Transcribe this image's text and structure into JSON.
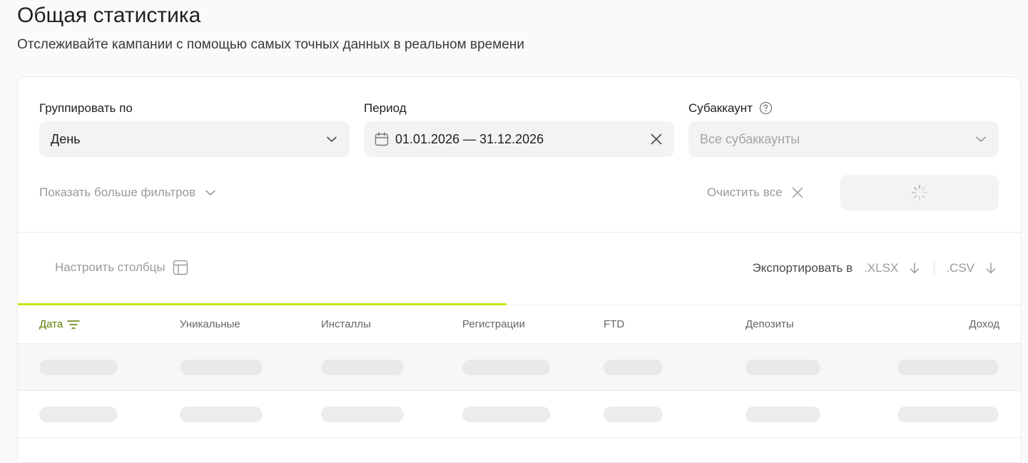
{
  "header": {
    "title": "Общая статистика",
    "subtitle": "Отслеживайте кампании с помощью самых точных данных в реальном времени"
  },
  "filters": {
    "group_by": {
      "label": "Группировать по",
      "value": "День",
      "icon": "chevron-down-icon"
    },
    "period": {
      "label": "Период",
      "value": "01.01.2026 — 31.12.2026",
      "icon": "calendar-icon",
      "clear_icon": "close-icon"
    },
    "subaccount": {
      "label": "Субаккаунт",
      "placeholder": "Все субаккаунты",
      "help_icon": "question-circle-icon",
      "icon": "chevron-down-icon"
    },
    "more_filters_label": "Показать больше фильтров",
    "clear_all_label": "Очистить все",
    "apply_state": "loading"
  },
  "toolbar": {
    "configure_columns_label": "Настроить столбцы",
    "export_label": "Экспортировать в",
    "export_xlsx": ".XLSX",
    "export_csv": ".CSV"
  },
  "loading_progress": 0.487,
  "table": {
    "columns": [
      "Дата",
      "Уникальные",
      "Инсталлы",
      "Регистрации",
      "FTD",
      "Депозиты",
      "Доход"
    ],
    "sorted_column": "Дата",
    "rows_state": "loading"
  },
  "colors": {
    "accent": "#c6e61a",
    "accent_text": "#5a7f00",
    "muted_text": "#9a9a9a",
    "field_bg": "#f3f3f3"
  }
}
